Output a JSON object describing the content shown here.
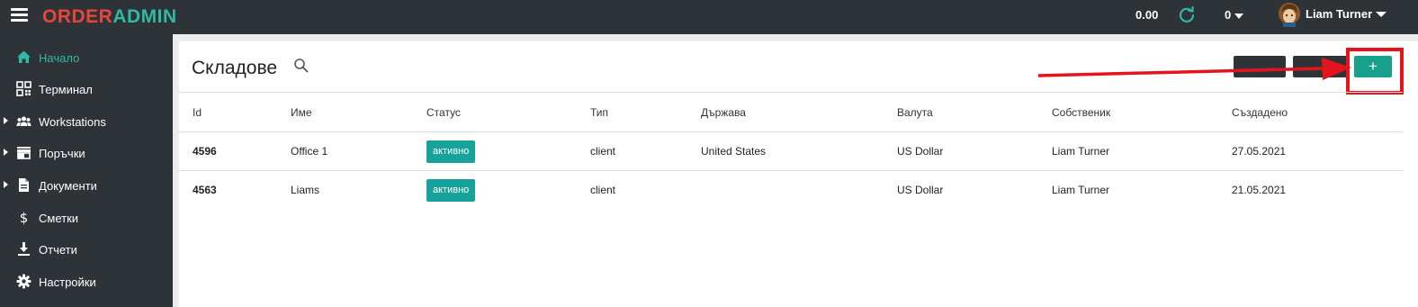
{
  "header": {
    "logo_order": "ORDER",
    "logo_admin": "ADMIN",
    "balance": "0.00",
    "count": "0",
    "username": "Liam Turner"
  },
  "sidebar": {
    "items": [
      {
        "label": "Начало",
        "icon": "home-icon",
        "active": true,
        "expandable": false
      },
      {
        "label": "Терминал",
        "icon": "qr-code-icon",
        "active": false,
        "expandable": false
      },
      {
        "label": "Workstations",
        "icon": "users-icon",
        "active": false,
        "expandable": true
      },
      {
        "label": "Поръчки",
        "icon": "store-icon",
        "active": false,
        "expandable": true
      },
      {
        "label": "Документи",
        "icon": "document-icon",
        "active": false,
        "expandable": true
      },
      {
        "label": "Сметки",
        "icon": "dollar-icon",
        "active": false,
        "expandable": false
      },
      {
        "label": "Отчети",
        "icon": "download-icon",
        "active": false,
        "expandable": false
      },
      {
        "label": "Настройки",
        "icon": "gear-icon",
        "active": false,
        "expandable": false
      }
    ]
  },
  "main": {
    "title": "Складове",
    "add_label": "+",
    "table": {
      "columns": [
        "Id",
        "Име",
        "Статус",
        "Тип",
        "Държава",
        "Валута",
        "Собственик",
        "Създадено"
      ],
      "rows": [
        {
          "id": "4596",
          "name": "Office 1",
          "status": "активно",
          "type": "client",
          "country": "United States",
          "currency": "US Dollar",
          "owner": "Liam Turner",
          "created": "27.05.2021"
        },
        {
          "id": "4563",
          "name": "Liams",
          "status": "активно",
          "type": "client",
          "country": "",
          "currency": "US Dollar",
          "owner": "Liam Turner",
          "created": "21.05.2021"
        }
      ]
    }
  },
  "colors": {
    "accent": "#2fb9a6",
    "brand_red": "#e8463a",
    "status_active": "#17a39a",
    "dark": "#2e3338",
    "annotation": "#e5131b"
  }
}
